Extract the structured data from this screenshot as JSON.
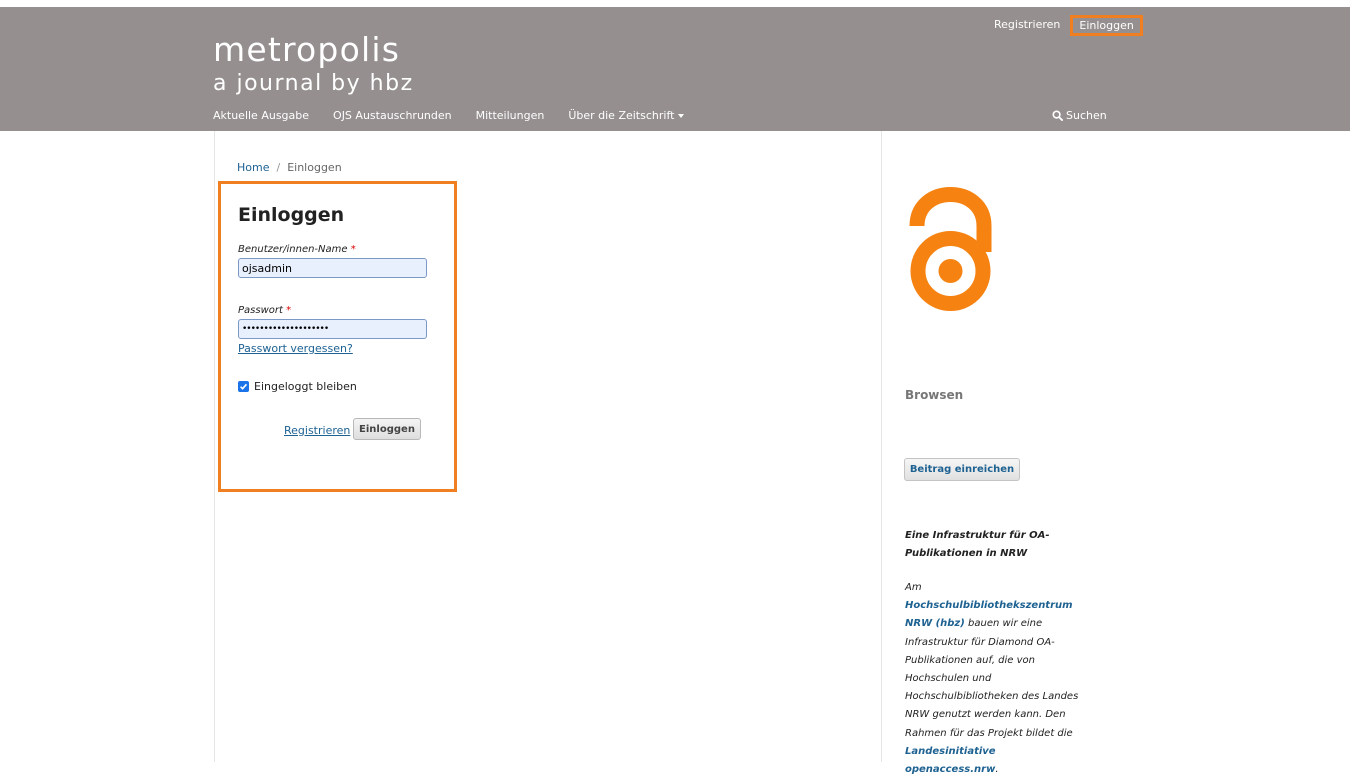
{
  "header": {
    "site_title": "metropolis",
    "site_subtitle": "a journal by hbz",
    "user_nav": {
      "register": "Registrieren",
      "login": "Einloggen"
    },
    "primary_nav": [
      {
        "label": "Aktuelle Ausgabe"
      },
      {
        "label": "OJS Austauschrunden"
      },
      {
        "label": "Mitteilungen"
      },
      {
        "label": "Über die Zeitschrift"
      }
    ],
    "search_label": "Suchen",
    "background_color": "#958f8f",
    "highlight_color": "#f07f22"
  },
  "breadcrumb": {
    "home": "Home",
    "separator": "/",
    "current": "Einloggen"
  },
  "login_form": {
    "title": "Einloggen",
    "username_label": "Benutzer/innen-Name",
    "username_value": "ojsadmin",
    "password_label": "Passwort",
    "password_value": "••••••••••••••••••••",
    "required_marker": "*",
    "forgot_password": "Passwort vergessen?",
    "remember_label": "Eingeloggt bleiben",
    "remember_checked": true,
    "register_link": "Registrieren",
    "login_button": "Einloggen"
  },
  "sidebar": {
    "logo_icon": "open-access-lock-icon",
    "logo_color": "#f68212",
    "browse_title": "Browsen",
    "submit_button": "Beitrag einreichen",
    "info_heading": "Eine Infrastruktur für OA-Publikationen in NRW",
    "info_text": {
      "part1": "Am ",
      "link1": "Hochschulbibliothekszentrum NRW (hbz)",
      "part2": " bauen wir eine Infrastruktur für Diamond OA-Publikationen auf, die von Hochschulen und Hochschulbibliotheken des Landes NRW genutzt werden kann. Den Rahmen für das Projekt bildet die ",
      "link2": "Landesinitiative openaccess.nrw",
      "part3": "."
    }
  }
}
